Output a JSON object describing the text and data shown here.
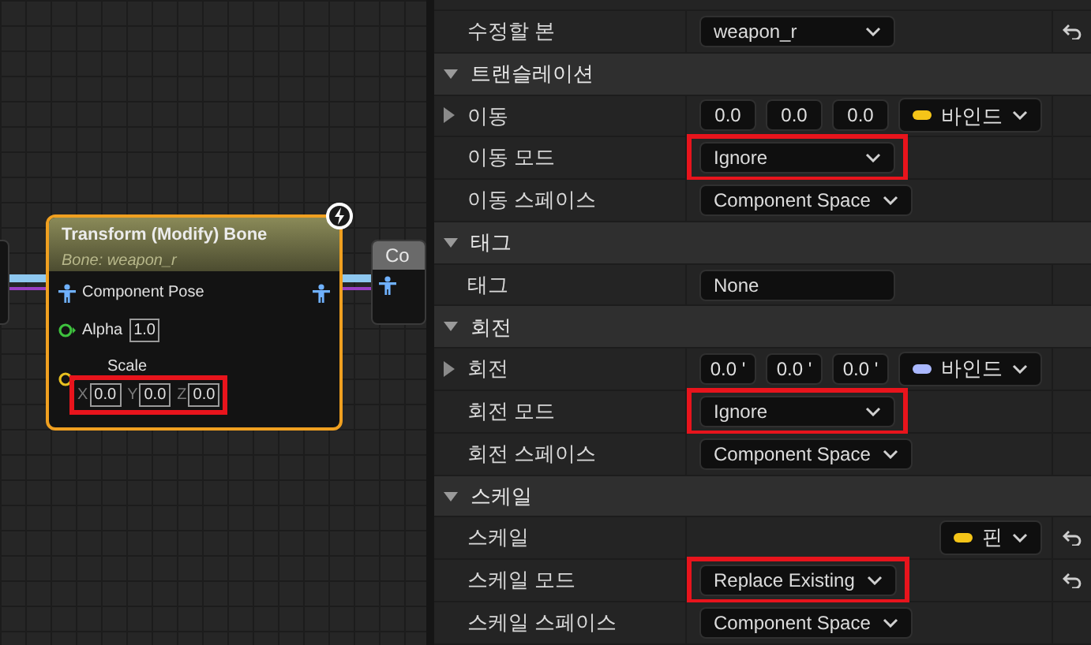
{
  "graph": {
    "node": {
      "title": "Transform (Modify) Bone",
      "subtitle": "Bone: weapon_r",
      "pins": [
        {
          "kind": "pose",
          "label": "Component Pose"
        },
        {
          "kind": "float",
          "label": "Alpha",
          "value": "1.0"
        },
        {
          "kind": "vector",
          "label": "Scale",
          "highlighted": true,
          "fields": [
            {
              "axis": "X",
              "value": "0.0"
            },
            {
              "axis": "Y",
              "value": "0.0"
            },
            {
              "axis": "Z",
              "value": "0.0"
            }
          ]
        }
      ]
    },
    "next_node": {
      "title": "Co"
    }
  },
  "details": {
    "rows": [
      {
        "kind": "dropdown",
        "label": "수정할 본",
        "value": "weapon_r",
        "highlighted": false,
        "resettable": true
      },
      {
        "kind": "header",
        "label": "트랜슬레이션"
      },
      {
        "kind": "vector",
        "label": "이동",
        "values": [
          "0.0",
          "0.0",
          "0.0"
        ],
        "binding": {
          "label": "바인드",
          "color": "#f5c518"
        },
        "resettable": false
      },
      {
        "kind": "dropdown",
        "label": "이동 모드",
        "value": "Ignore",
        "highlighted": true,
        "resettable": false
      },
      {
        "kind": "dropdown",
        "label": "이동 스페이스",
        "value": "Component Space",
        "highlighted": false,
        "resettable": false
      },
      {
        "kind": "header",
        "label": "태그"
      },
      {
        "kind": "text",
        "label": "태그",
        "value": "None"
      },
      {
        "kind": "header",
        "label": "회전"
      },
      {
        "kind": "vector",
        "label": "회전",
        "values": [
          "0.0 '",
          "0.0 '",
          "0.0 '"
        ],
        "binding": {
          "label": "바인드",
          "color": "#aab8ff"
        },
        "resettable": false
      },
      {
        "kind": "dropdown",
        "label": "회전 모드",
        "value": "Ignore",
        "highlighted": true,
        "resettable": false
      },
      {
        "kind": "dropdown",
        "label": "회전 스페이스",
        "value": "Component Space",
        "highlighted": false,
        "resettable": false
      },
      {
        "kind": "header",
        "label": "스케일"
      },
      {
        "kind": "pin",
        "label": "스케일",
        "binding": {
          "label": "핀",
          "color": "#f5c518"
        },
        "resettable": true
      },
      {
        "kind": "dropdown",
        "label": "스케일 모드",
        "value": "Replace Existing",
        "highlighted": true,
        "resettable": true
      },
      {
        "kind": "dropdown",
        "label": "스케일 스페이스",
        "value": "Component Space",
        "highlighted": false,
        "resettable": false
      }
    ]
  }
}
